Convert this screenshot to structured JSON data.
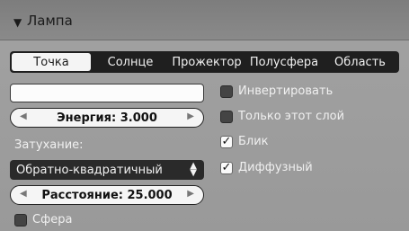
{
  "panel": {
    "title": "Лампа",
    "collapse_icon": "triangle-down-icon"
  },
  "tabs": [
    {
      "label": "Точка",
      "active": true
    },
    {
      "label": "Солнце",
      "active": false
    },
    {
      "label": "Прожектор",
      "active": false
    },
    {
      "label": "Полусфера",
      "active": false
    },
    {
      "label": "Область",
      "active": false
    }
  ],
  "color_field": {
    "value": ""
  },
  "energy": {
    "label": "Энергия: 3.000"
  },
  "falloff": {
    "label": "Затухание:",
    "selected": "Обратно-квадратичный"
  },
  "distance": {
    "label": "Расстояние: 25.000"
  },
  "sphere": {
    "label": "Сфера",
    "checked": false
  },
  "options": {
    "invert": {
      "label": "Инвертировать",
      "checked": false
    },
    "this_layer_only": {
      "label": "Только этот слой",
      "checked": false
    },
    "specular": {
      "label": "Блик",
      "checked": true
    },
    "diffuse": {
      "label": "Диффузный",
      "checked": true
    }
  }
}
